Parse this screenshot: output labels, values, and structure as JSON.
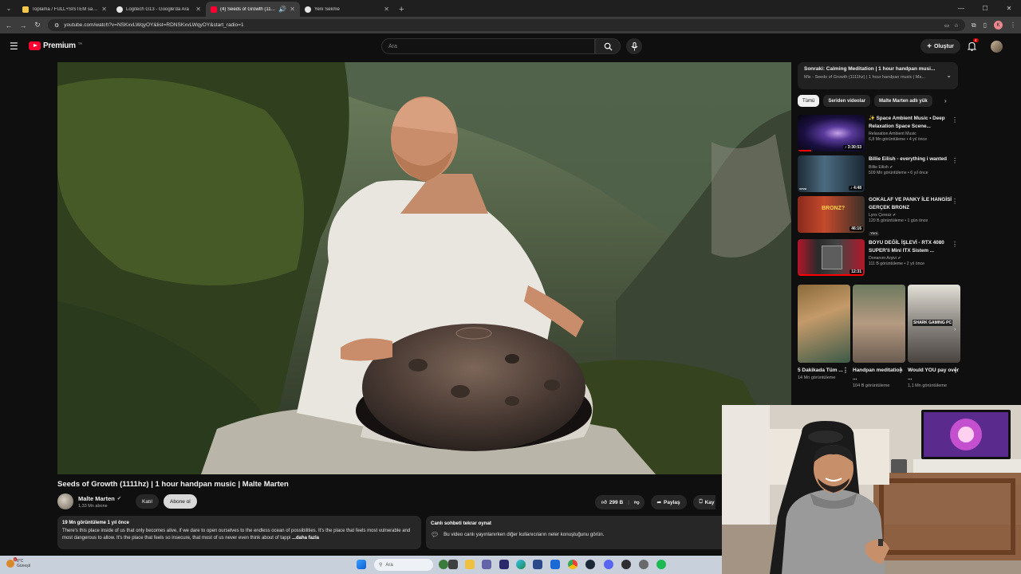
{
  "browser": {
    "tabs": [
      {
        "title": "Toplama / FULL+SİSTEM sahib...",
        "color": "#f2c94c",
        "active": false
      },
      {
        "title": "Logitech G13 - Google'da Ara",
        "color": "#e6e6e6",
        "active": false
      },
      {
        "title": "(4) Seeds of Growth (1111h...",
        "color": "#ff0033",
        "active": true
      },
      {
        "title": "Yeni Sekme",
        "color": "#e6e6e6",
        "active": false
      }
    ],
    "url": "youtube.com/watch?v=NSKxvLWqyOY&list=RDNSKxvLWqyOY&start_radio=1"
  },
  "header": {
    "logo_text": "Premium",
    "logo_suffix": "TR",
    "search_placeholder": "Ara",
    "create_label": "Oluştur",
    "notifications": "4",
    "brand_color": "#ff0033"
  },
  "video": {
    "title": "Seeds of Growth (1111hz) | 1 hour handpan music | Malte Marten",
    "channel": "Malte Marten",
    "subscribers": "1,33 Mn abone",
    "join_label": "Katıl",
    "subscribe_label": "Abone ol",
    "likes": "299 B",
    "share_label": "Paylaş",
    "save_label": "Kay"
  },
  "description": {
    "meta": "19 Mn görüntüleme  1 yıl önce",
    "text": "There's this place inside of us that only becomes alive, if we dare to open ourselves to the endless ocean of possibilities. It's the place that feels most vulnerable and most dangerous to allow. It's the place that feels so insecure, that most of us never even think about of tappi",
    "more": "...daha fazla"
  },
  "chat_replay": {
    "title": "Canlı sohbeti tekrar oynat",
    "text": "Bu video canlı yayınlanırken diğer kullanıcıların neler konuştuğunu görün."
  },
  "up_next": {
    "title": "Sonraki: Calming Meditation | 1 hour handpan musi...",
    "subtitle": "Mix - Seeds of Growth (1111hz) | 1 hour handpan music | Ma..."
  },
  "chips": [
    "Tümü",
    "Seriden videolar",
    "Malte Marten adlı yük"
  ],
  "recommendations": [
    {
      "title": "✨ Space Ambient Music • Deep Relaxation Space Scene...",
      "channel": "Relaxation Ambient Music",
      "stats": "6,8 Mn görüntüleme • 4 yıl önce",
      "duration": "3:30:53",
      "verified": false,
      "new": false,
      "progress": 0.2
    },
    {
      "title": "Billie Eilish - everything i wanted",
      "channel": "Billie Eilish",
      "stats": "509 Mn görüntüleme • 6 yıl önce",
      "duration": "4:48",
      "verified": true,
      "new": false,
      "progress": 0
    },
    {
      "title": "GOKALAF VE PANKY İLE HANGİSİ GERÇEK BRONZ",
      "channel": "Lynx Çerezz",
      "stats": "120 B görüntüleme • 1 gün önce",
      "duration": "46:16",
      "verified": true,
      "new": true,
      "new_label": "Yeni",
      "progress": 0
    },
    {
      "title": "BOYU DEĞİL İŞLEVİ - RTX 4080 SUPER'li Mini ITX Sistem ...",
      "channel": "Donanım Arşivi",
      "stats": "111 B görüntüleme • 2 yıl önce",
      "duration": "12:31",
      "verified": true,
      "new": false,
      "progress": 1
    }
  ],
  "shorts": [
    {
      "title": "5 Dakikada Tüm ...",
      "views": "14 Mn görüntüleme"
    },
    {
      "title": "Handpan meditation ...",
      "views": "104 B görüntüleme"
    },
    {
      "title": "Would YOU pay over ...",
      "views": "1,1 Mn görüntüleme"
    }
  ],
  "taskbar": {
    "temp": "8°C",
    "condition": "Güneşli",
    "search_placeholder": "Ara",
    "weather_badge": "1"
  }
}
